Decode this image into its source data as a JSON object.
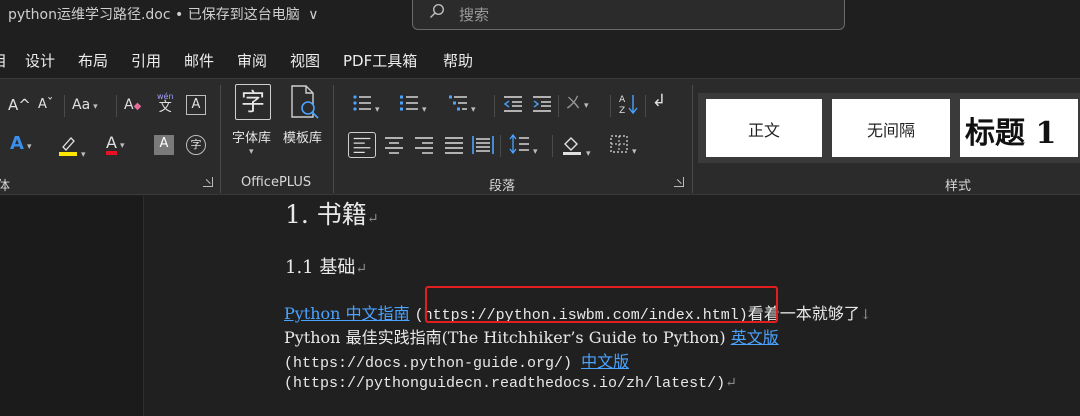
{
  "title_bar": {
    "document_title": "python运维学习路径.doc • 已保存到这台电脑",
    "dropdown_glyph": "∨",
    "search_placeholder": "搜索"
  },
  "menu": {
    "tabs": [
      "目",
      "设计",
      "布局",
      "引用",
      "邮件",
      "审阅",
      "视图",
      "PDF工具箱",
      "帮助"
    ]
  },
  "ribbon": {
    "font_group": {
      "grow_font": "A^",
      "shrink_font": "Aˇ",
      "change_case": "Aa",
      "clear_format": "A",
      "phonetic_guide": "wén",
      "phonetic_char": "文",
      "char_border": "A",
      "text_effect": "A",
      "highlight": "ab",
      "font_color": "A",
      "char_shading": "A",
      "enclose_char": "字",
      "label": "体"
    },
    "officeplus_group": {
      "font_library_label": "字体库",
      "template_library_label": "模板库",
      "font_library_glyph": "字",
      "label": "OfficePLUS"
    },
    "paragraph_group": {
      "label": "段落"
    },
    "styles_group": {
      "label": "样式",
      "styles": [
        "正文",
        "无间隔",
        "标题 1"
      ]
    }
  },
  "document": {
    "heading1": "1.  书籍",
    "heading2": "1.1  基础",
    "line1_link": "Python 中文指南",
    "line1_url": "(https://python.iswbm.com/index.html)",
    "line1_tail": "看着一本就够了",
    "line2_text": "Python 最佳实践指南(The Hitchhiker’s Guide to Python) ",
    "line2_link": "英文版",
    "line3_url": "(https://docs.python-guide.org/) ",
    "line3_link": "中文版",
    "line4_url": "(https://pythonguidecn.readthedocs.io/zh/latest/)",
    "paragraph_mark": "↵",
    "line_break_mark": "↓"
  },
  "colors": {
    "link": "#4aa3ff",
    "annotation_box": "#e21f1f",
    "highlight_yellow": "#ffe600",
    "font_red": "#e81123",
    "text_effect_blue": "#3b8eea"
  }
}
